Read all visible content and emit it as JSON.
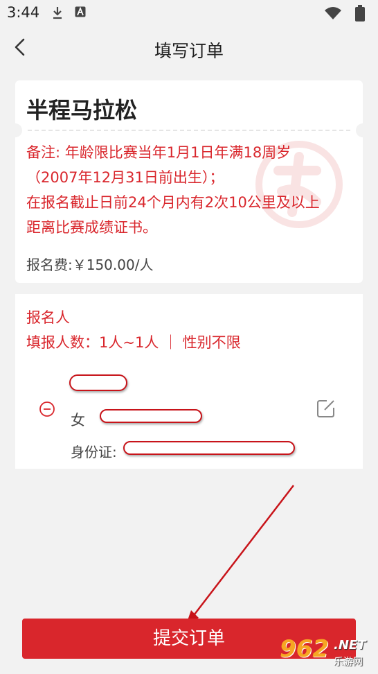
{
  "status_bar": {
    "time": "3:44",
    "icons": [
      "download-icon",
      "a-icon",
      "wifi-icon",
      "battery-icon"
    ]
  },
  "header": {
    "title": "填写订单",
    "back_icon": "chevron-left-icon"
  },
  "event": {
    "name": "半程马拉松",
    "note_lines": [
      "备注: 年龄限比赛当年1月1日年满18周岁",
      "（2007年12月31日前出生）；",
      "在报名截止日前24个月内有2次10公里及以上",
      "距离比赛成绩证书。"
    ],
    "fee": "报名费:￥150.00/人"
  },
  "registrant": {
    "title": "报名人",
    "count_info": "填报人数：1人~1人 ｜ 性别不限",
    "gender": "女",
    "id_label": "身份证:"
  },
  "submit": {
    "label": "提交订单"
  },
  "watermark_logo": {
    "number": "962",
    "suffix": ".NET",
    "cn": "乐游网"
  },
  "colors": {
    "accent": "#d9262c",
    "background": "#f2f2f2",
    "card": "#ffffff"
  }
}
